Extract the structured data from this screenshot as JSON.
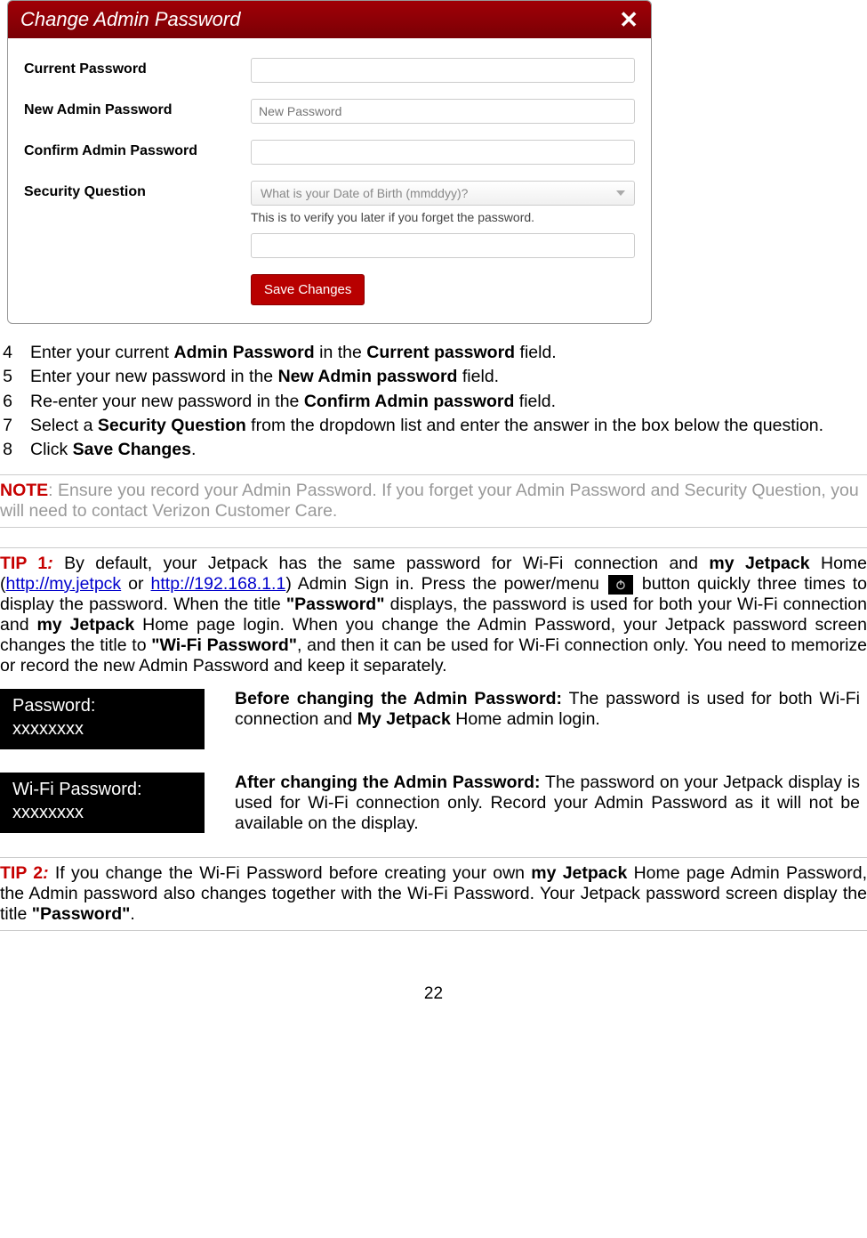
{
  "dialog": {
    "title": "Change Admin Password",
    "close_glyph": "✕",
    "labels": {
      "current": "Current Password",
      "newpw": "New Admin Password",
      "confirm": "Confirm Admin Password",
      "secq": "Security Question"
    },
    "placeholders": {
      "newpw": "New Password",
      "secq": "What is your Date of Birth (mmddyy)?"
    },
    "secq_help": "This is to verify you later if you forget the password.",
    "save_label": "Save Changes"
  },
  "steps": [
    {
      "n": "4",
      "parts": [
        "Enter your current ",
        "Admin Password",
        " in the ",
        "Current password",
        " field."
      ]
    },
    {
      "n": "5",
      "parts": [
        "Enter your new password in the ",
        "New Admin password",
        " field."
      ]
    },
    {
      "n": "6",
      "parts": [
        "Re-enter your new password in the ",
        "Confirm Admin password",
        " field."
      ]
    },
    {
      "n": "7",
      "parts": [
        "Select a ",
        "Security Question",
        " from the dropdown list and enter the answer in the box below the question."
      ]
    },
    {
      "n": "8",
      "parts": [
        "Click ",
        "Save Changes",
        "."
      ]
    }
  ],
  "note": {
    "label": "NOTE",
    "text": ": Ensure you record your Admin Password. If you forget your Admin Password and Security Question, you will need to contact Verizon Customer Care."
  },
  "tip1": {
    "label": "TIP 1",
    "colon": ":",
    "seg_a": " By default, your Jetpack has the same password for Wi-Fi connection and ",
    "b1": "my Jetpack",
    "seg_b": " Home (",
    "link1": "http://my.jetpck",
    "seg_c": " or ",
    "link2": "http://192.168.1.1",
    "seg_d": ") Admin Sign in. Press the power/menu ",
    "seg_e": " button quickly three times to display the password. When the title ",
    "b2": "\"Password\"",
    "seg_f": " displays, the password is used for both your Wi-Fi connection and ",
    "b3": "my Jetpack",
    "seg_g": " Home page login.  When you change the Admin Password, your Jetpack password screen changes the title to ",
    "b4": "\"Wi-Fi Password\"",
    "seg_h": ", and then it can be used for Wi-Fi connection only. You need to memorize or record the new Admin Password and keep it separately."
  },
  "badges": {
    "before": {
      "line1": "Password:",
      "line2": "xxxxxxxx",
      "desc_b1": "Before changing the Admin Password:",
      "desc_a": " The password is used for both Wi-Fi connection and ",
      "desc_b2": "My Jetpack",
      "desc_b": " Home admin login."
    },
    "after": {
      "line1": "Wi-Fi Password:",
      "line2": "xxxxxxxx",
      "desc_b1": "After changing the Admin Password:",
      "desc_a": " The password on your Jetpack display is used for Wi-Fi connection only. Record your Admin Password as it will not be available on the display."
    }
  },
  "tip2": {
    "label": "TIP 2",
    "colon": ":",
    "seg_a": " If you change the Wi-Fi Password before creating your own ",
    "b1": "my Jetpack",
    "seg_b": " Home page Admin Password, the Admin password also changes together with the Wi-Fi Password. Your Jetpack password screen display the title ",
    "b2": "\"Password\"",
    "seg_c": "."
  },
  "page_number": "22"
}
